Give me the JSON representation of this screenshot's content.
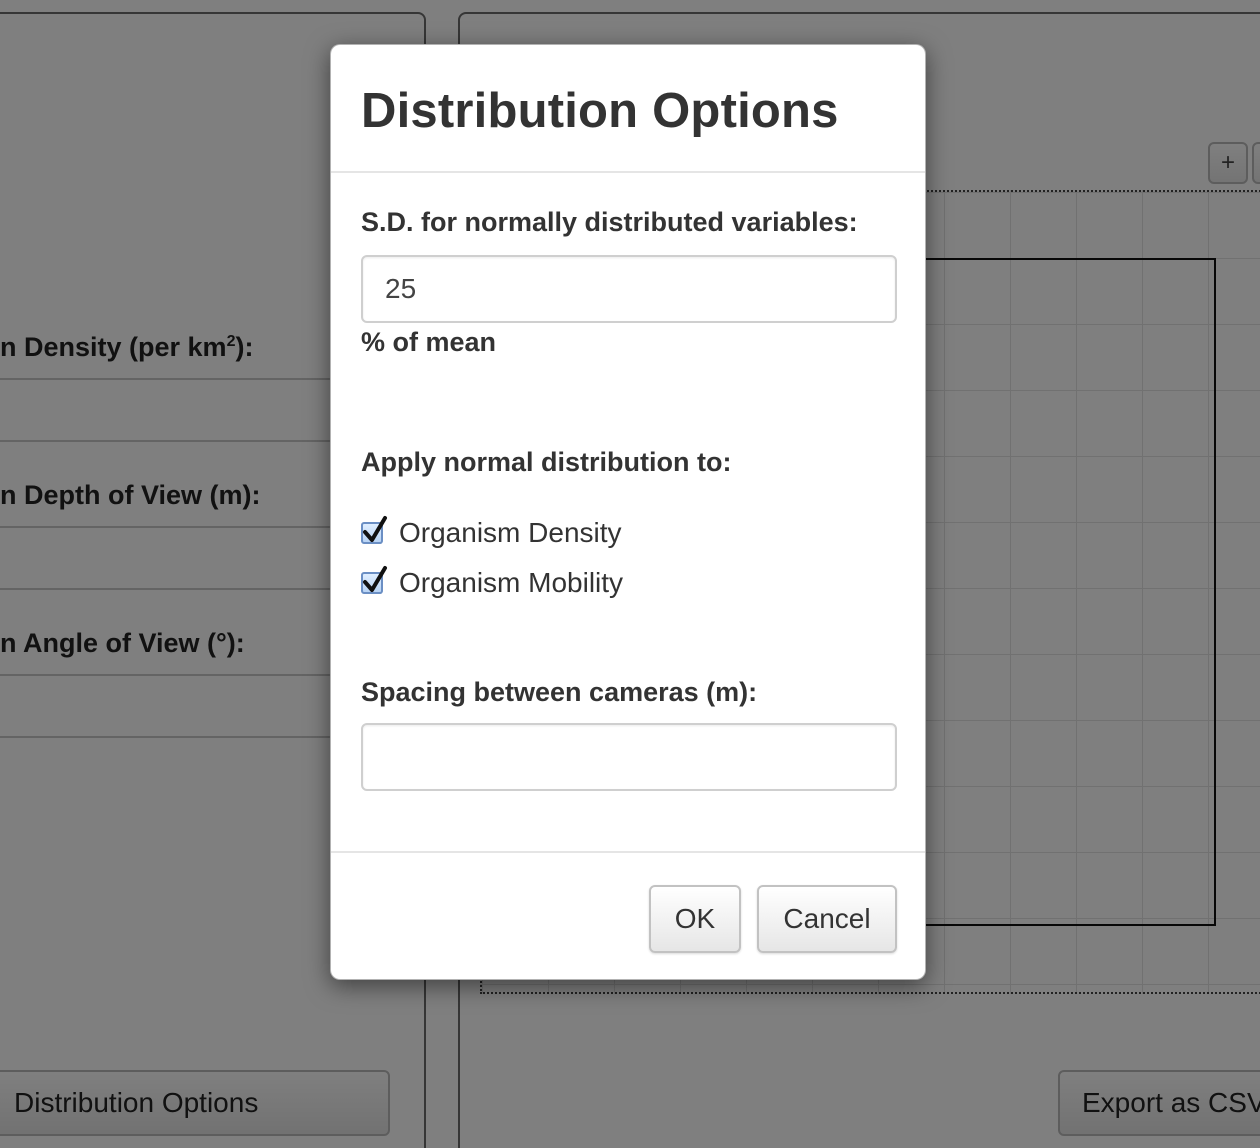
{
  "background": {
    "fields": [
      {
        "label": "n Density (per km",
        "sup": "2",
        "suffix": "):"
      },
      {
        "label": "n Depth of View (m):"
      },
      {
        "label": "n Angle of View (°):"
      }
    ],
    "distribution_button": "Distribution Options",
    "export_button": "Export as CSV",
    "zoom_in": "+"
  },
  "modal": {
    "title": "Distribution Options",
    "sd_label": "S.D. for normally distributed variables:",
    "sd_value": "25",
    "sd_unit": "% of mean",
    "apply_label": "Apply normal distribution to:",
    "checkboxes": [
      {
        "label": "Organism Density",
        "checked": true
      },
      {
        "label": "Organism Mobility",
        "checked": true
      }
    ],
    "spacing_label": "Spacing between cameras (m):",
    "spacing_value": "",
    "ok_label": "OK",
    "cancel_label": "Cancel"
  }
}
